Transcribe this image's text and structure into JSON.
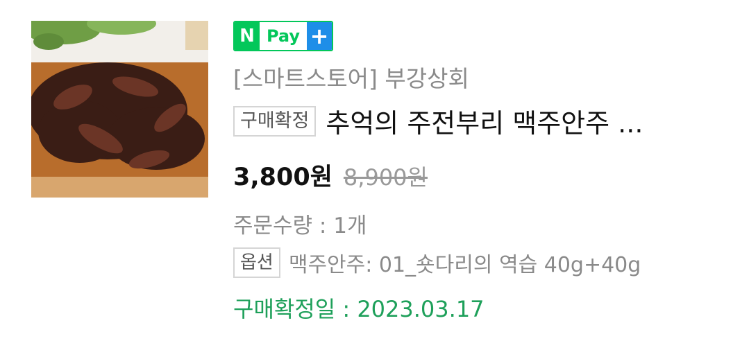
{
  "product": {
    "image_alt": "product-photo",
    "badge": {
      "n": "N",
      "pay": "Pay",
      "plus": "+"
    },
    "store": "[스마트스토어] 부강상회",
    "status_tag": "구매확정",
    "title": "추억의 주전부리 맥주안주 ...",
    "price": "3,800원",
    "original_price": "8,900원",
    "quantity": "주문수량 : 1개",
    "option_tag": "옵션",
    "option": "맥주안주: 01_숏다리의 역습 40g+40g",
    "confirmed_date": "구매확정일 : 2023.03.17"
  },
  "colors": {
    "npay_green": "#03c75a",
    "npay_blue": "#1e8ee8",
    "confirm_green": "#1ea05a"
  }
}
